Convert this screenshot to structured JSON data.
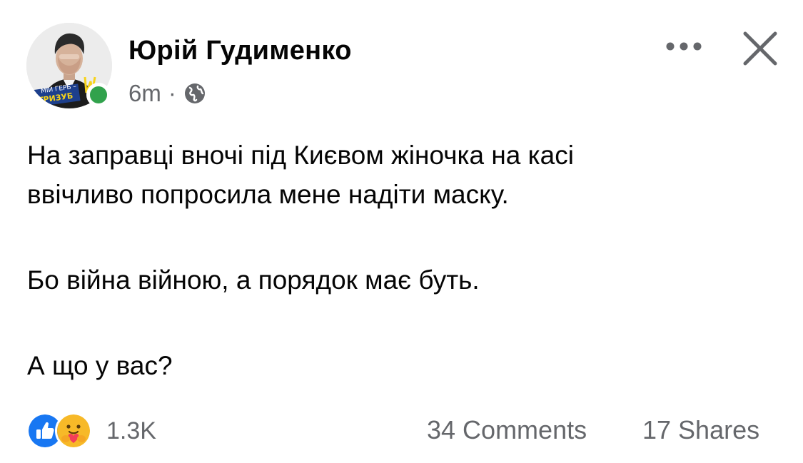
{
  "post": {
    "author": {
      "name": "Юрій Гудименко",
      "avatar_logo_text_line1": "МІЙ ГЕРБ –",
      "avatar_logo_text_line2": "ТРИЗУБ",
      "online": true
    },
    "timestamp": "6m",
    "separator": "·",
    "privacy_icon": "globe-icon",
    "paragraphs": [
      {
        "line1": "На заправці вночі під Києвом жіночка на касі",
        "line2": "ввічливо попросила мене надіти маску."
      },
      {
        "line1": "Бо війна війною, а порядок має буть."
      },
      {
        "line1": "А що у вас?"
      }
    ],
    "reactions": {
      "icons": [
        "like-icon",
        "care-icon"
      ],
      "count": "1.3K"
    },
    "comments": "34 Comments",
    "shares": "17 Shares"
  },
  "colors": {
    "text_primary": "#050505",
    "text_secondary": "#65676b",
    "like_blue": "#1877f2",
    "care_yellow": "#f7b928",
    "online_green": "#31a24c"
  }
}
